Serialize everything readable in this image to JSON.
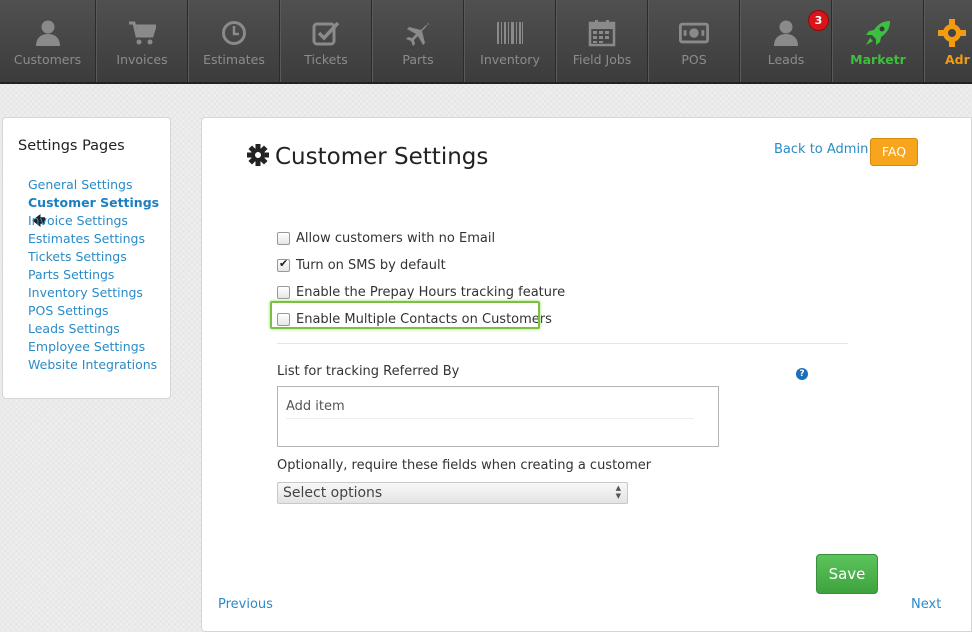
{
  "navbar": {
    "items": [
      {
        "label": "Customers",
        "icon": "user-icon"
      },
      {
        "label": "Invoices",
        "icon": "cart-icon"
      },
      {
        "label": "Estimates",
        "icon": "clock-icon"
      },
      {
        "label": "Tickets",
        "icon": "check-square-icon"
      },
      {
        "label": "Parts",
        "icon": "plane-icon"
      },
      {
        "label": "Inventory",
        "icon": "barcode-icon"
      },
      {
        "label": "Field Jobs",
        "icon": "calendar-icon"
      },
      {
        "label": "POS",
        "icon": "money-icon"
      },
      {
        "label": "Leads",
        "icon": "user-icon",
        "badge": "3"
      },
      {
        "label": "Marketr",
        "icon": "rocket-icon"
      },
      {
        "label": "Adr",
        "icon": "gear-icon"
      }
    ],
    "colors": {
      "marketr": "#3fbf3f",
      "admin": "#f39c12",
      "badge": "#d9141b"
    }
  },
  "sidebar": {
    "title": "Settings Pages",
    "items": [
      {
        "label": "General Settings"
      },
      {
        "label": "Customer Settings",
        "active": true
      },
      {
        "label": "Invoice Settings"
      },
      {
        "label": "Estimates Settings"
      },
      {
        "label": "Tickets Settings"
      },
      {
        "label": "Parts Settings"
      },
      {
        "label": "Inventory Settings"
      },
      {
        "label": "POS Settings"
      },
      {
        "label": "Leads Settings"
      },
      {
        "label": "Employee Settings"
      },
      {
        "label": "Website Integrations"
      }
    ],
    "active_arrow": "🡄"
  },
  "main": {
    "title": "Customer Settings",
    "back_label": "Back to Admin",
    "faq_label": "FAQ",
    "checkboxes": [
      {
        "label": "Allow customers with no Email",
        "checked": false
      },
      {
        "label": "Turn on SMS by default",
        "checked": true
      },
      {
        "label": "Enable the Prepay Hours tracking feature",
        "checked": false
      },
      {
        "label": "Enable Multiple Contacts on Customers",
        "checked": false,
        "highlighted": true
      }
    ],
    "referred_label": "List for tracking Referred By",
    "help_glyph": "?",
    "add_item_placeholder": "Add item",
    "optional_label": "Optionally, require these fields when creating a customer",
    "select_value": "Select options",
    "save_label": "Save",
    "previous_label": "Previous",
    "next_label": "Next"
  }
}
